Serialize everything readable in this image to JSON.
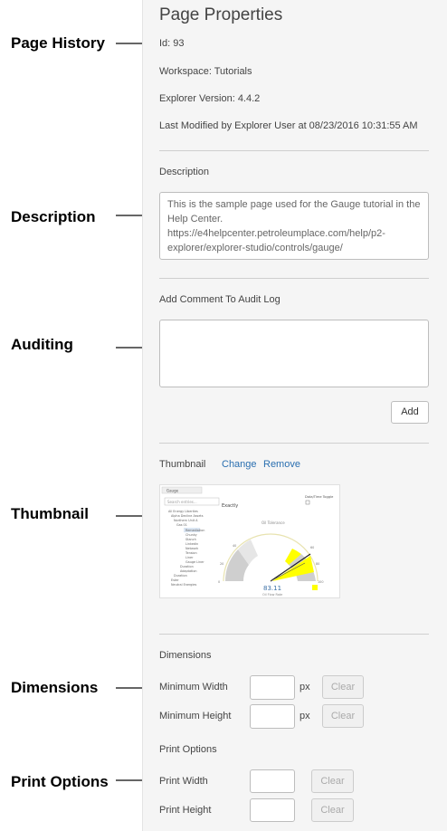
{
  "annotations": {
    "page_history": "Page History",
    "description": "Description",
    "auditing": "Auditing",
    "thumbnail": "Thumbnail",
    "dimensions": "Dimensions",
    "print_options": "Print Options"
  },
  "panel": {
    "title": "Page Properties",
    "id_line": "Id: 93",
    "workspace_line": "Workspace: Tutorials",
    "version_line": "Explorer Version: 4.4.2",
    "modified_line": "Last Modified by Explorer User at 08/23/2016 10:31:55 AM"
  },
  "description": {
    "label": "Description",
    "value": "This is the sample page used for the Gauge tutorial in the Help Center. https://e4helpcenter.petroleumplace.com/help/p2-explorer/explorer-studio/controls/gauge/"
  },
  "audit": {
    "label": "Add Comment To Audit Log",
    "value": "",
    "add_label": "Add"
  },
  "thumbnail": {
    "label": "Thumbnail",
    "change_label": "Change",
    "remove_label": "Remove",
    "preview": {
      "tab_title": "Gauge",
      "search_placeholder": "Search entries...",
      "tree_items": [
        "All Energy Liberties",
        "Alpha Decline Assets",
        "Northern Unit A",
        "Gas 01",
        "Remediation",
        "Chunky",
        "Stanch",
        "Linkedin",
        "Network",
        "Tension",
        "Liner",
        "Gauge Liner",
        "Duration",
        "Adaptation",
        "Duration",
        "Ester",
        "Neutral Energies"
      ],
      "title": "Exactly",
      "toggle_label": "Data/Time Toggle",
      "gauge_caption": "Oil Tolerance",
      "gauge_value": "83.11",
      "gauge_sublabel": "Oil Flow Rate",
      "tick_labels": [
        "0",
        "20",
        "40",
        "60",
        "80",
        "100"
      ]
    }
  },
  "dimensions": {
    "label": "Dimensions",
    "min_width_label": "Minimum Width",
    "min_width_value": "",
    "min_height_label": "Minimum Height",
    "min_height_value": "",
    "unit": "px",
    "clear_label": "Clear"
  },
  "print_options": {
    "label": "Print Options",
    "width_label": "Print Width",
    "width_value": "",
    "height_label": "Print Height",
    "height_value": "",
    "clear_label": "Clear"
  },
  "colors": {
    "panel_bg": "#f5f5f5",
    "link": "#2a6fb0",
    "gauge_yellow": "#ffff00",
    "gauge_value": "#3a6fa5"
  }
}
